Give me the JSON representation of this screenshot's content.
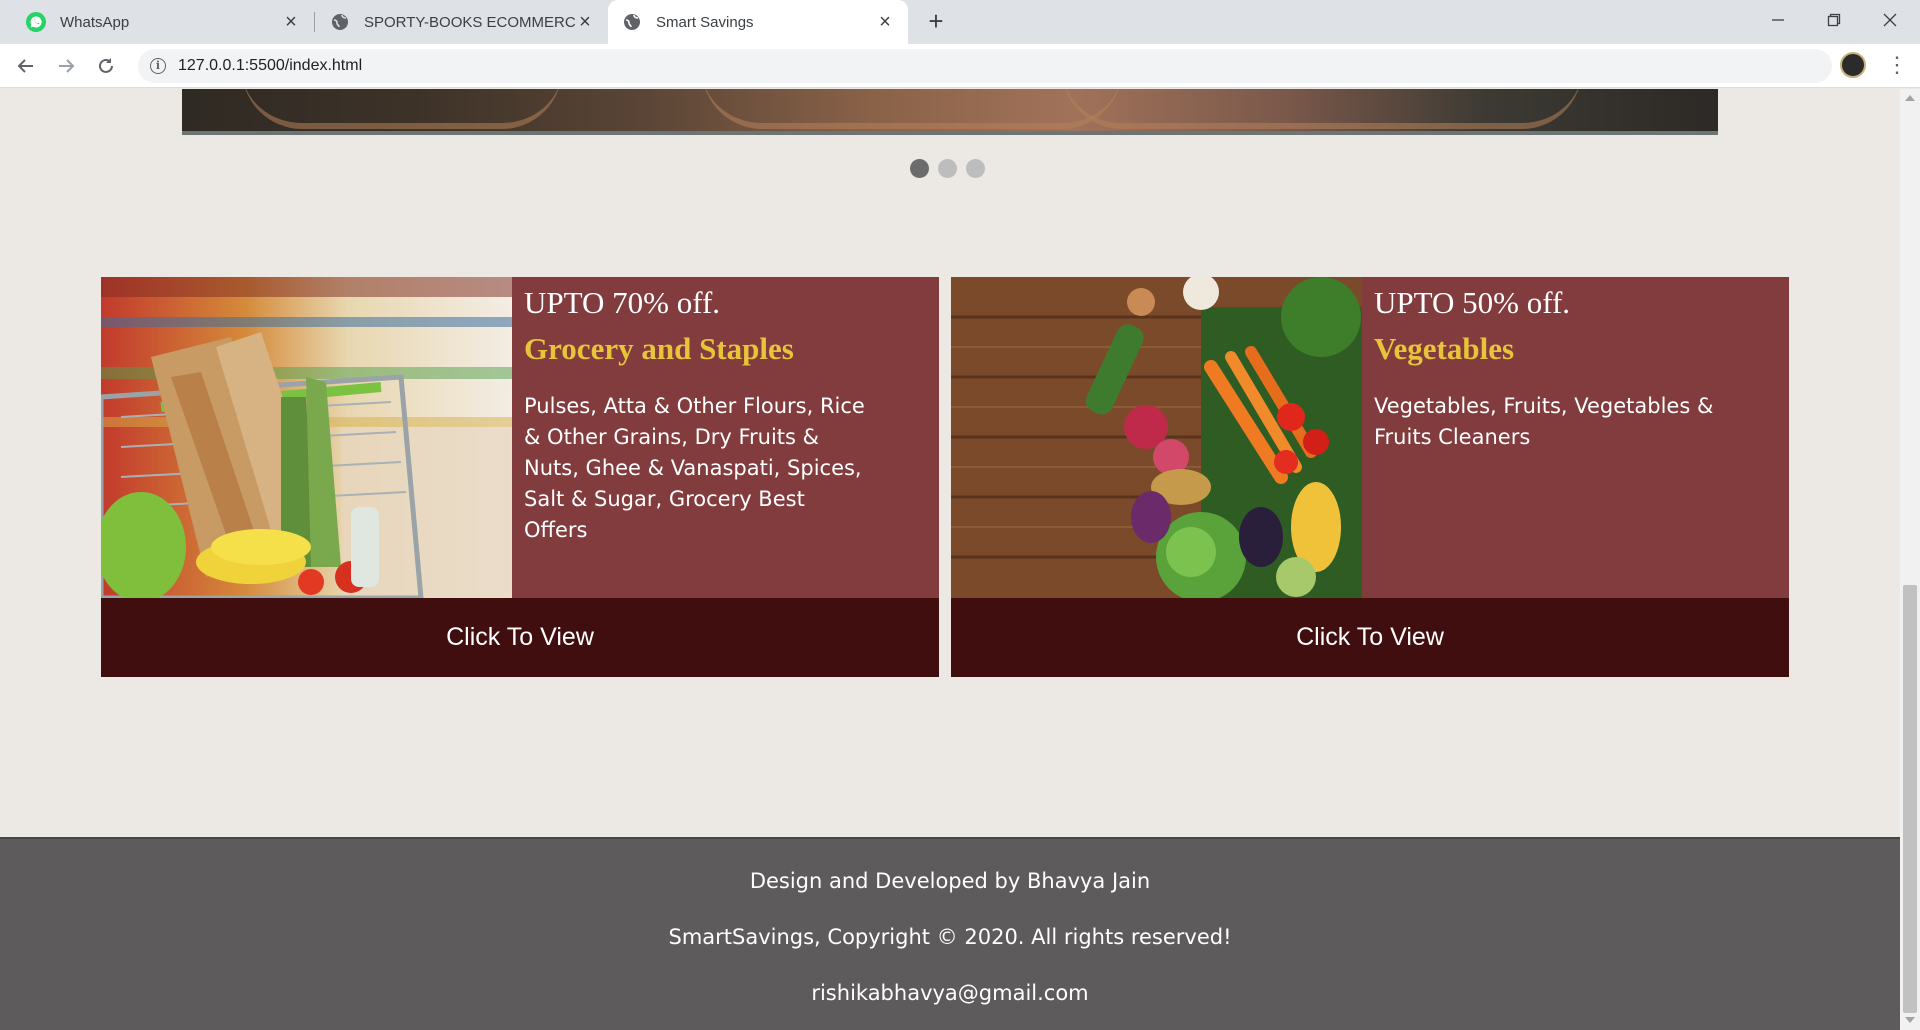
{
  "browser": {
    "tabs": [
      {
        "title": "WhatsApp",
        "icon": "whatsapp-icon",
        "active": false
      },
      {
        "title": "SPORTY-BOOKS ECOMMERCE",
        "icon": "globe-icon",
        "active": false
      },
      {
        "title": "Smart Savings",
        "icon": "globe-icon",
        "active": true
      }
    ],
    "new_tab_label": "+",
    "url": "127.0.0.1:5500/index.html",
    "window_controls": {
      "minimize": "–",
      "maximize": "❐",
      "close": "✕"
    }
  },
  "carousel": {
    "slide_count": 3,
    "active_index": 0
  },
  "cards": [
    {
      "offer": "UPTO 70% off.",
      "category": "Grocery and Staples",
      "description": "Pulses, Atta & Other Flours, Rice & Other Grains, Dry Fruits & Nuts, Ghee & Vanaspati, Spices, Salt & Sugar, Grocery Best Offers",
      "button": "Click To View",
      "image": "grocery-cart-image"
    },
    {
      "offer": "UPTO 50% off.",
      "category": "Vegetables",
      "description": "Vegetables, Fruits, Vegetables & Fruits Cleaners",
      "button": "Click To View",
      "image": "vegetables-image"
    }
  ],
  "footer": {
    "credit": "Design and Developed by Bhavya Jain",
    "copyright": "SmartSavings, Copyright © 2020. All rights reserved!",
    "email": "rishikabhavya@gmail.com"
  },
  "colors": {
    "card_bg": "#823c3e",
    "cta_bg": "#410e10",
    "accent_gold": "#e8c43a",
    "footer_bg": "#5d5b5b",
    "page_bg": "#ece8e3"
  }
}
